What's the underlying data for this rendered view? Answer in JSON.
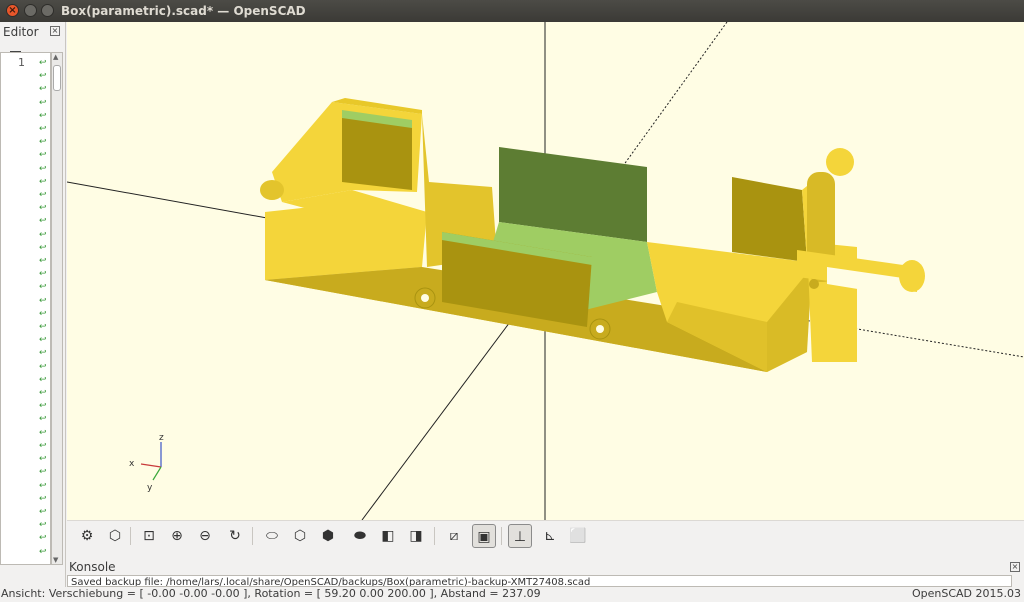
{
  "window": {
    "title": "Box(parametric).scad* — OpenSCAD",
    "close_glyph": "×"
  },
  "editor": {
    "label": "Editor",
    "close_glyph": "×",
    "more_glyph": "»",
    "line_number": "1",
    "wrap_glyph": "↩"
  },
  "viewport": {
    "background": "#fffde4",
    "model_color": "#f4d53a",
    "model_shadow": "#a99310",
    "highlight_color": "#9fcd63",
    "axes_labels": {
      "z": "z",
      "x": "x",
      "y": "y"
    }
  },
  "toolbar": [
    {
      "name": "preview-button",
      "glyph": "⚙"
    },
    {
      "name": "render-button",
      "glyph": "⬡"
    },
    {
      "name": "view-all-button",
      "glyph": "⊡"
    },
    {
      "name": "zoom-in-button",
      "glyph": "⊕"
    },
    {
      "name": "zoom-out-button",
      "glyph": "⊖"
    },
    {
      "name": "reset-view-button",
      "glyph": "↻"
    },
    {
      "name": "view-right-button",
      "glyph": "⬭"
    },
    {
      "name": "view-top-button",
      "glyph": "⬡"
    },
    {
      "name": "view-bottom-button",
      "glyph": "⬢"
    },
    {
      "name": "view-left-button",
      "glyph": "⬬"
    },
    {
      "name": "view-front-button",
      "glyph": "◧"
    },
    {
      "name": "view-back-button",
      "glyph": "◨"
    },
    {
      "name": "perspective-button",
      "glyph": "⧄"
    },
    {
      "name": "orthogonal-button",
      "glyph": "▣"
    },
    {
      "name": "show-axes-button",
      "glyph": "⊥"
    },
    {
      "name": "show-scale-button",
      "glyph": "⊾"
    },
    {
      "name": "show-edges-button",
      "glyph": "⬜"
    }
  ],
  "console": {
    "label": "Konsole",
    "close_glyph": "×",
    "text": "Saved backup file: /home/lars/.local/share/OpenSCAD/backups/Box(parametric)-backup-XMT27408.scad"
  },
  "statusbar": {
    "left": "Ansicht: Verschiebung = [ -0.00 -0.00 -0.00 ], Rotation = [ 59.20 0.00 200.00 ], Abstand = 237.09",
    "right": "OpenSCAD 2015.03"
  }
}
